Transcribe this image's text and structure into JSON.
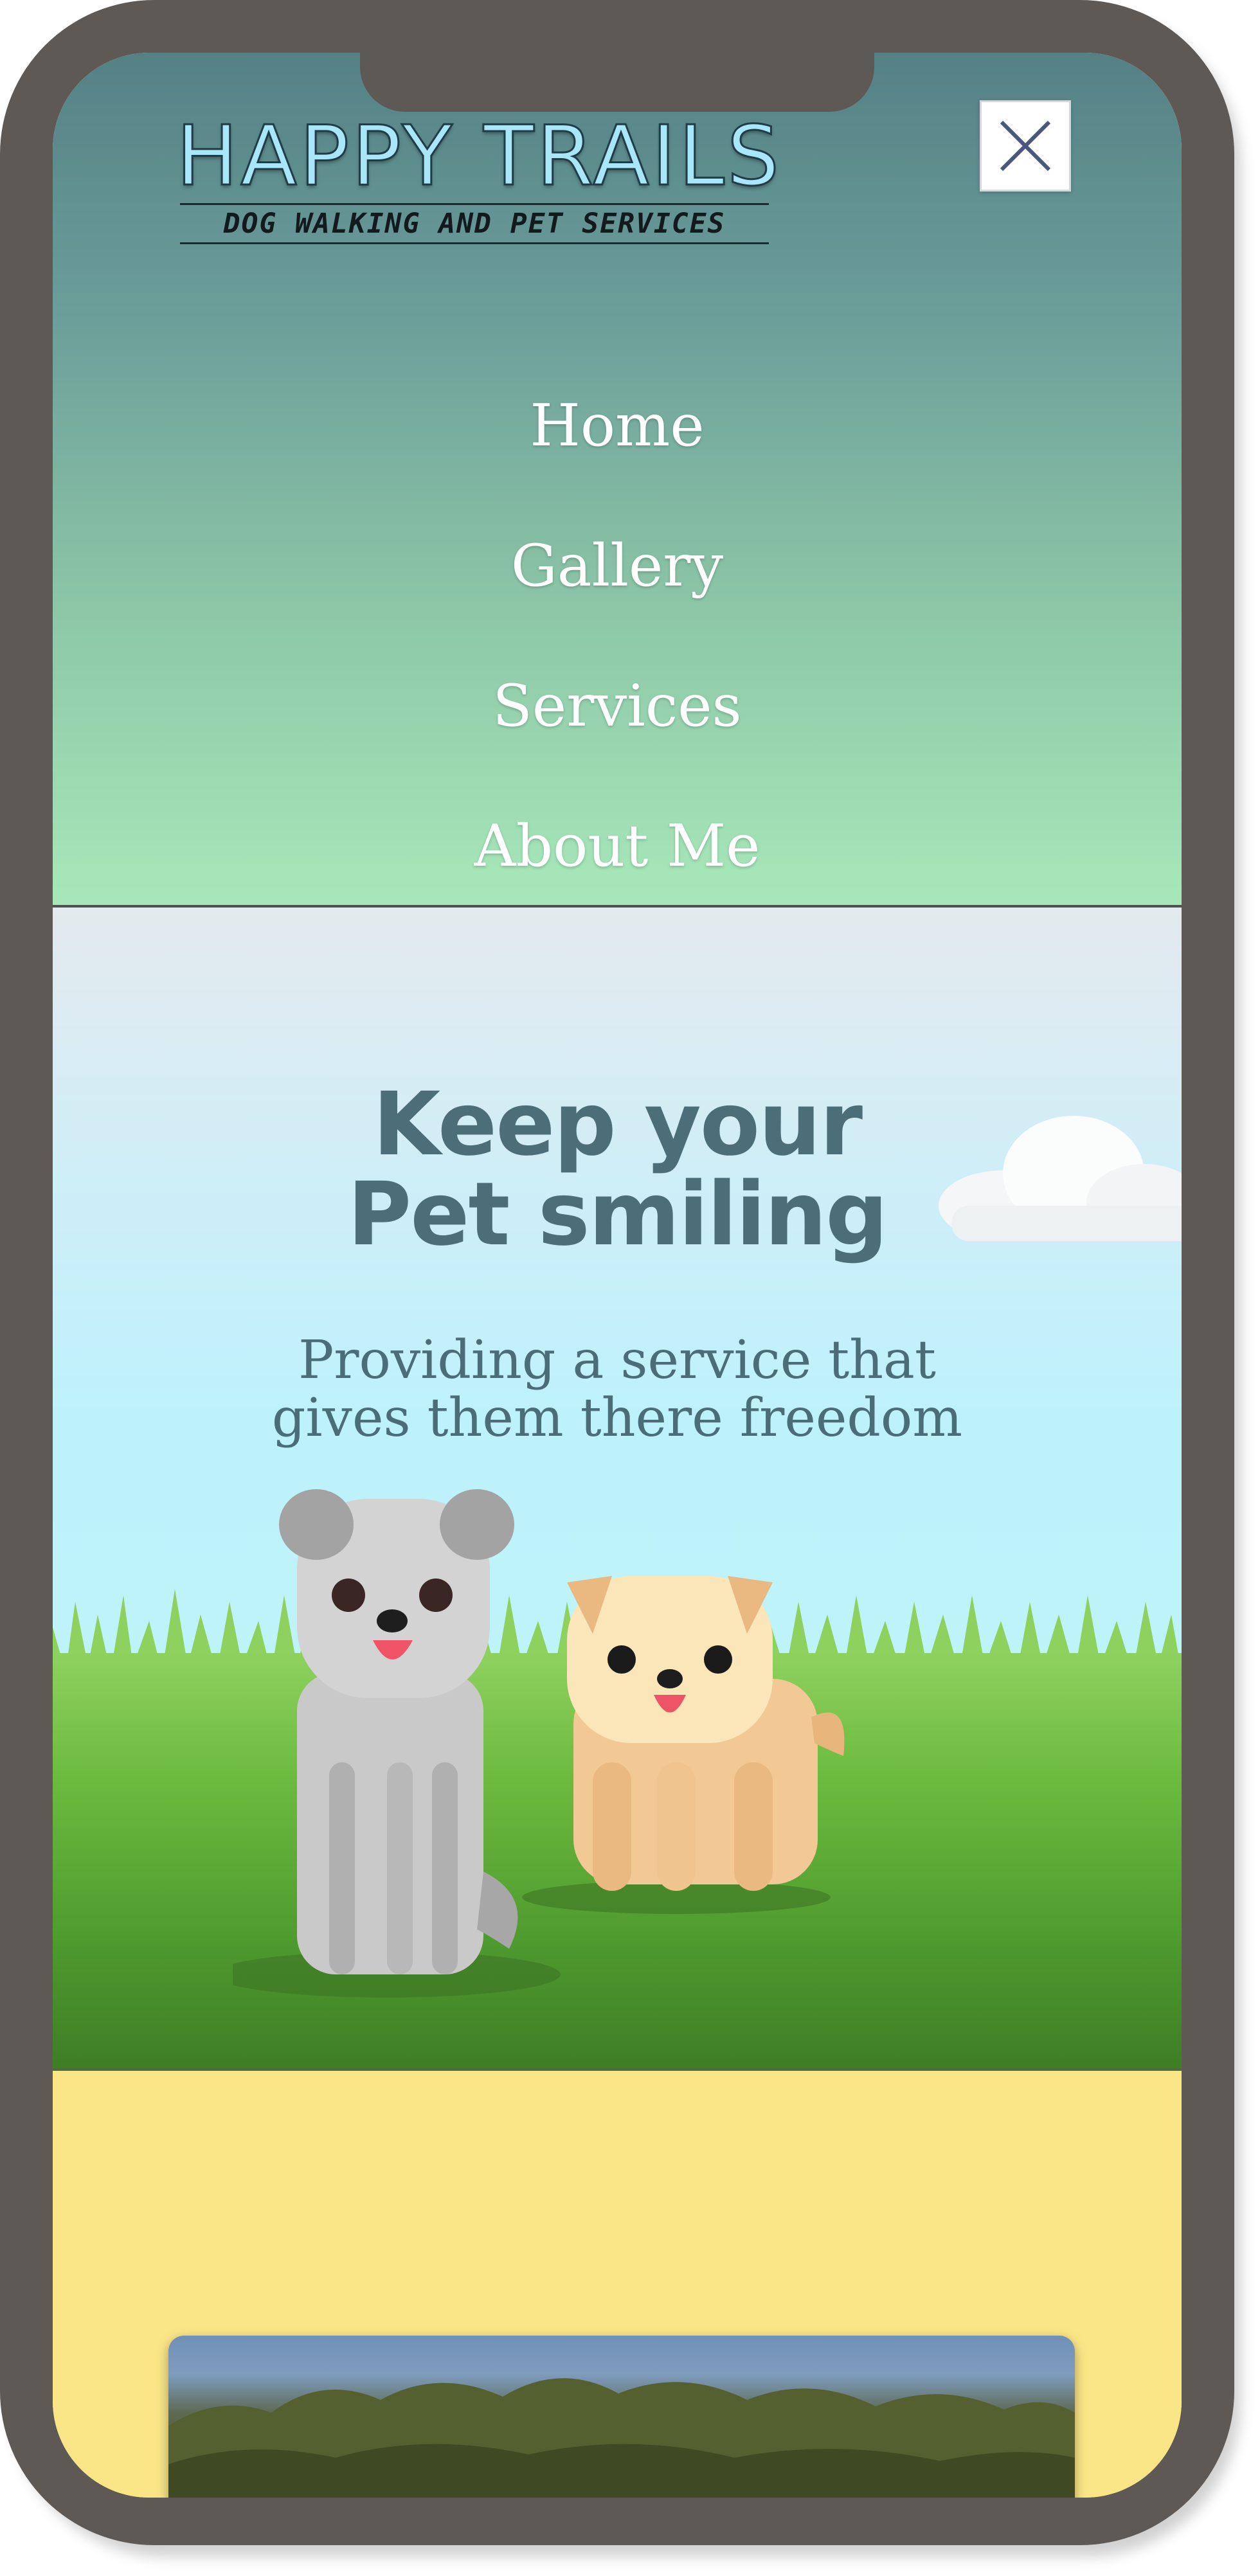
{
  "logo": {
    "title": "HAPPY TRAILS",
    "tagline": "DOG WALKING AND PET SERVICES"
  },
  "menu": {
    "close_icon": "close-icon",
    "items": [
      {
        "label": "Home"
      },
      {
        "label": "Gallery"
      },
      {
        "label": "Services"
      },
      {
        "label": "About Me"
      }
    ]
  },
  "hero": {
    "title_line1": "Keep your",
    "title_line2": "Pet smiling",
    "subtitle_line1": "Providing a service that",
    "subtitle_line2": "gives them there freedom"
  },
  "colors": {
    "menu_gradient_top": "#558186",
    "menu_gradient_bottom": "#a7e8b9",
    "hero_heading": "#4c6e79",
    "yellow_section": "#fbe687",
    "phone_frame": "#5e5955"
  }
}
